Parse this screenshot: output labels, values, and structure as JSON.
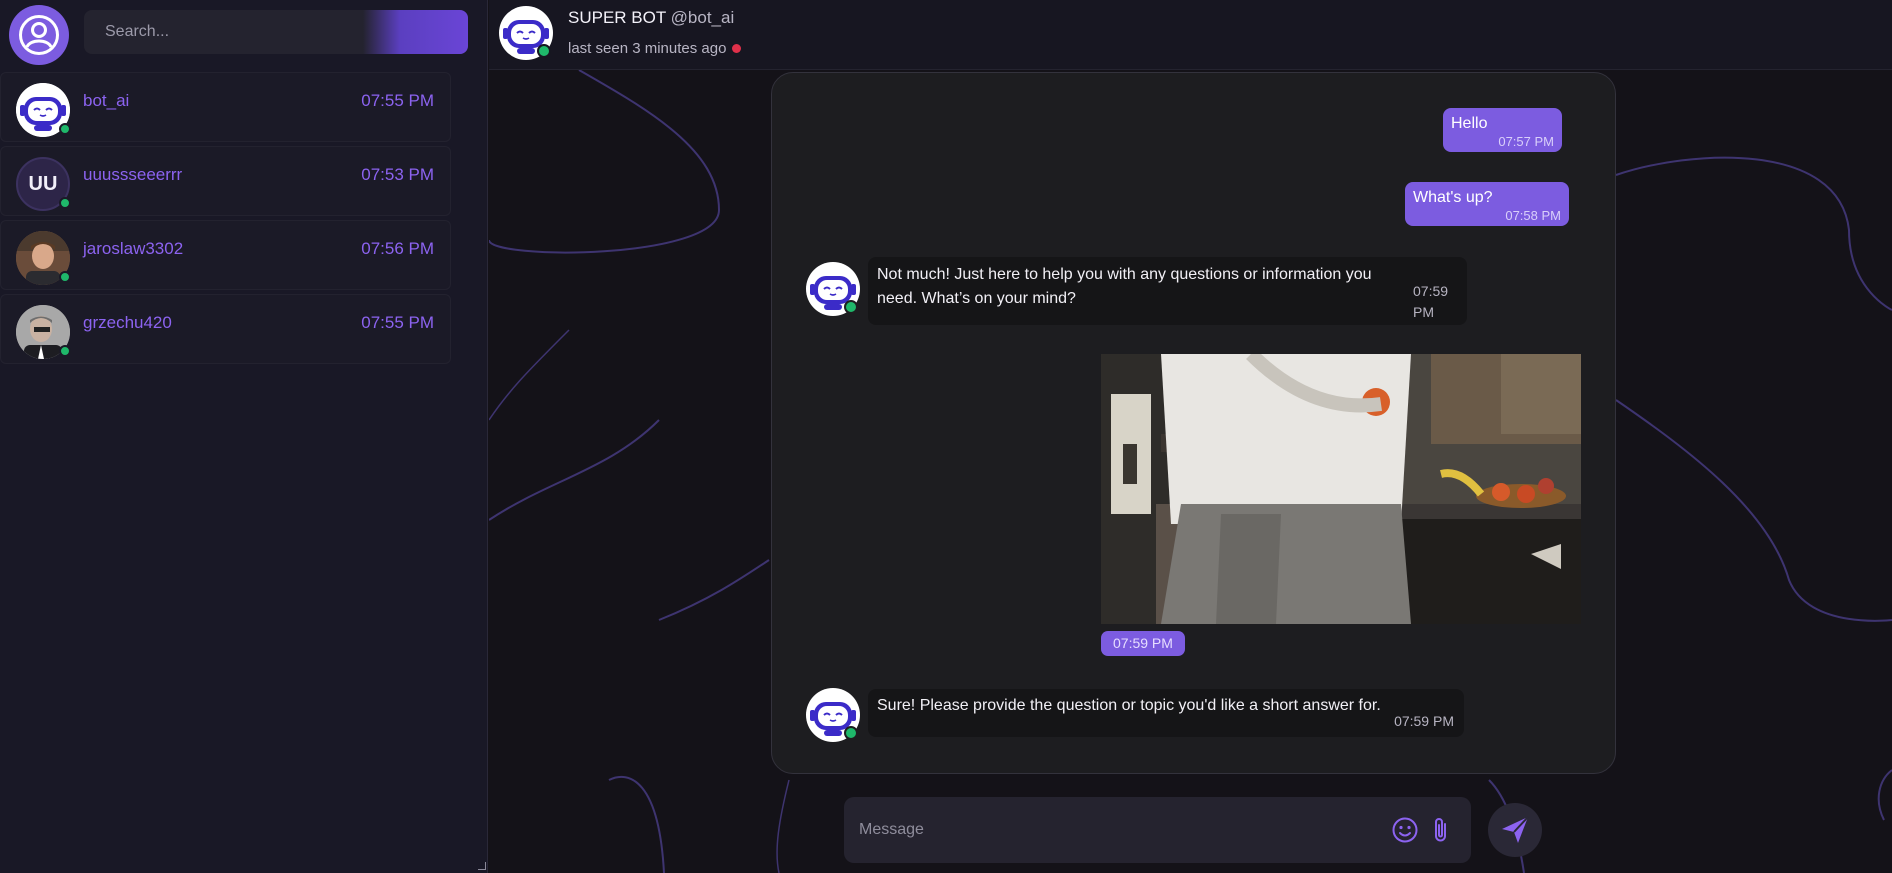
{
  "search": {
    "placeholder": "Search..."
  },
  "chats": [
    {
      "name": "bot_ai",
      "time": "07:55 PM",
      "avatar": "robot-avatar",
      "online": true
    },
    {
      "name": "uuussseeerrr",
      "time": "07:53 PM",
      "avatar_initials": "UU",
      "online": true
    },
    {
      "name": "jaroslaw3302",
      "time": "07:56 PM",
      "avatar": "photo-avatar",
      "online": true
    },
    {
      "name": "grzechu420",
      "time": "07:55 PM",
      "avatar": "photo-avatar",
      "online": true
    }
  ],
  "header": {
    "name": "SUPER BOT",
    "handle": "@bot_ai",
    "status": "last seen 3 minutes ago",
    "status_color": "#e0304a"
  },
  "messages": [
    {
      "direction": "out",
      "text": "Hello",
      "time": "07:57 PM"
    },
    {
      "direction": "out",
      "text": "What's up?",
      "time": "07:58 PM"
    },
    {
      "direction": "in",
      "text_line1": "Not much! Just here to help you with any questions or information you",
      "text_line2": "need. What’s on your mind?",
      "time_line1": "07:59",
      "time_line2": "PM"
    },
    {
      "direction": "out",
      "type": "video",
      "time": "07:59 PM"
    },
    {
      "direction": "in",
      "text": "Sure! Please provide the question or topic you'd like a short answer for.",
      "time": "07:59 PM"
    }
  ],
  "composer": {
    "placeholder": "Message"
  },
  "colors": {
    "accent": "#7c5ce0",
    "online": "#1fb86a",
    "link": "#8c63f0"
  },
  "icons": [
    "user-circle-icon",
    "emoji-icon",
    "paperclip-icon",
    "send-icon",
    "robot-icon"
  ]
}
